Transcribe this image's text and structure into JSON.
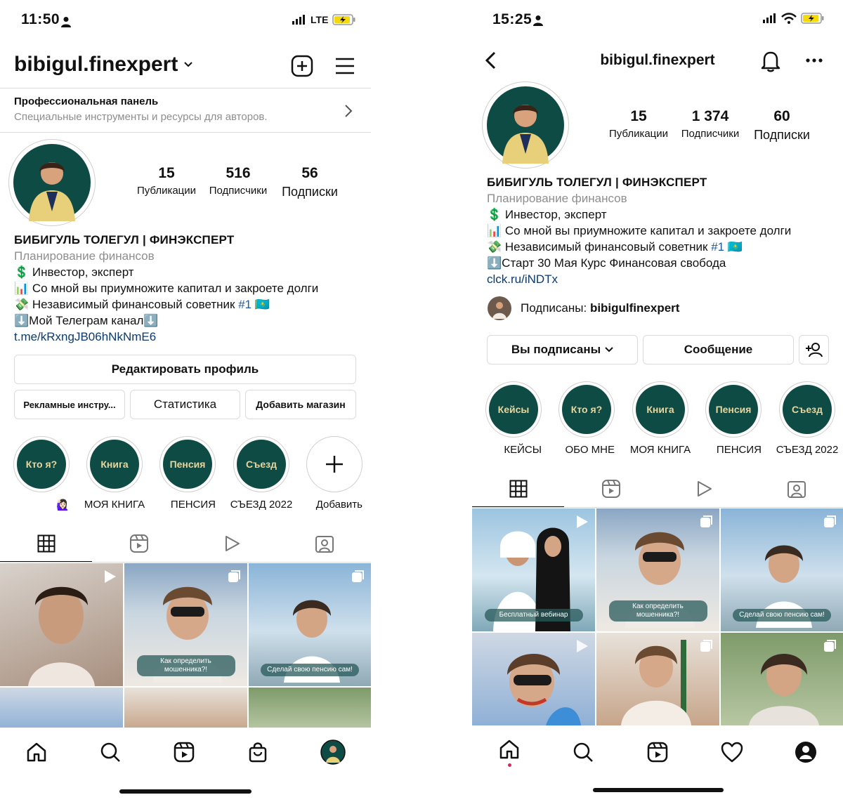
{
  "left": {
    "status": {
      "time": "11:50",
      "network": "LTE"
    },
    "header": {
      "username": "bibigul.finexpert"
    },
    "pro_panel": {
      "title": "Профессиональная панель",
      "subtitle": "Специальные инструменты и ресурсы для авторов."
    },
    "stats": [
      {
        "value": "15",
        "label": "Публикации"
      },
      {
        "value": "516",
        "label": "Подписчики"
      },
      {
        "value": "56",
        "label": "Подписки"
      }
    ],
    "bio": {
      "name": "БИБИГУЛЬ ТОЛЕГУЛ | ФИНЭКСПЕРТ",
      "category": "Планирование финансов",
      "line1": "💲 Инвестор, эксперт",
      "line2": "📊 Со мной вы приумножите капитал и закроете долги",
      "line3_pre": "💸 Независимый финансовый советник ",
      "line3_tag": "#1",
      "line3_post": " 🇰🇿",
      "line4": "⬇️Мой Телеграм канал⬇️",
      "link": "t.me/kRxngJB06hNkNmE6"
    },
    "buttons": {
      "edit_profile": "Редактировать профиль",
      "ads": "Рекламные инстру...",
      "stats": "Статистика",
      "add_shop": "Добавить магазин"
    },
    "highlights": [
      {
        "title": "Кто я?",
        "caption": "🙋🏻‍♀️"
      },
      {
        "title": "Книга",
        "caption": "МОЯ КНИГА"
      },
      {
        "title": "Пенсия",
        "caption": "ПЕНСИЯ"
      },
      {
        "title": "Съезд",
        "caption": "СЪЕЗД 2022"
      }
    ],
    "add_highlight": "Добавить",
    "posts": [
      {
        "caption": ""
      },
      {
        "caption": "Как определить мошенника?!"
      },
      {
        "caption": "Сделай свою пенсию сам!"
      },
      {
        "caption": ""
      },
      {
        "caption": ""
      },
      {
        "caption": ""
      }
    ]
  },
  "right": {
    "status": {
      "time": "15:25"
    },
    "header": {
      "username": "bibigul.finexpert"
    },
    "stats": [
      {
        "value": "15",
        "label": "Публикации"
      },
      {
        "value": "1 374",
        "label": "Подписчики"
      },
      {
        "value": "60",
        "label": "Подписки"
      }
    ],
    "bio": {
      "name": "БИБИГУЛЬ ТОЛЕГУЛ | ФИНЭКСПЕРТ",
      "category": "Планирование финансов",
      "line1": "💲 Инвестор, эксперт",
      "line2": "📊 Со мной вы приумножите капитал и закроете долги",
      "line3_pre": "💸 Независимый финансовый советник ",
      "line3_tag": "#1",
      "line3_post": " 🇰🇿",
      "line4": "⬇️Старт 30 Мая Курс Финансовая свобода",
      "link": "clck.ru/iNDTx"
    },
    "followed_by_prefix": "Подписаны: ",
    "followed_by_user": "bibigulfinexpert",
    "buttons": {
      "following": "Вы подписаны",
      "message": "Сообщение"
    },
    "highlights": [
      {
        "title": "Кейсы",
        "caption": "КЕЙСЫ"
      },
      {
        "title": "Кто я?",
        "caption": "ОБО МНЕ"
      },
      {
        "title": "Книга",
        "caption": "МОЯ КНИГА"
      },
      {
        "title": "Пенсия",
        "caption": "ПЕНСИЯ"
      },
      {
        "title": "Съезд",
        "caption": "СЪЕЗД 2022"
      }
    ],
    "posts": [
      {
        "caption": "Бесплатный вебинар"
      },
      {
        "caption": "Как определить мошенника?!"
      },
      {
        "caption": "Сделай свою пенсию сам!"
      },
      {
        "caption": ""
      },
      {
        "caption": ""
      },
      {
        "caption": ""
      }
    ]
  },
  "colors": {
    "highlight_bg": "#0f4b45",
    "highlight_text": "#e9d59a",
    "link": "#0b3a6e",
    "battery": "#f5d90a"
  }
}
